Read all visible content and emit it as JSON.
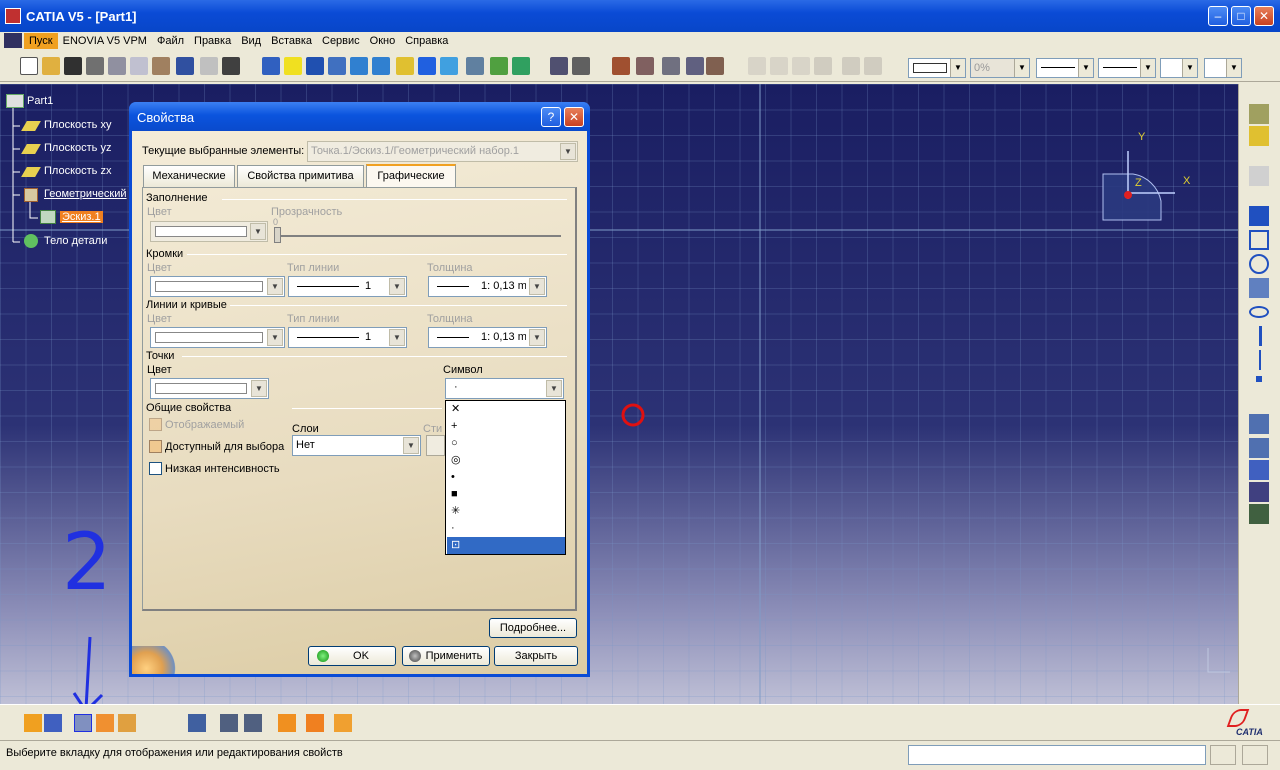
{
  "window": {
    "title": "CATIA V5 - [Part1]"
  },
  "menu": [
    "Пуск",
    "ENOVIA V5 VPM",
    "Файл",
    "Правка",
    "Вид",
    "Вставка",
    "Сервис",
    "Окно",
    "Справка"
  ],
  "toolbar": {
    "combo_percent": "0%"
  },
  "tree": {
    "root": "Part1",
    "items": [
      "Плоскость xy",
      "Плоскость yz",
      "Плоскость zx",
      "Геометрический",
      "Эскиз.1",
      "Тело детали"
    ]
  },
  "axes": {
    "y": "Y",
    "x": "X",
    "z": "Z"
  },
  "dialog": {
    "title": "Свойства",
    "help": "?",
    "selected_label": "Текущие выбранные элементы:",
    "selected_value": "Точка.1/Эскиз.1/Геометрический набор.1",
    "tabs": [
      "Механические",
      "Свойства примитива",
      "Графические"
    ],
    "fill": {
      "section": "Заполнение",
      "color": "Цвет",
      "transparency": "Прозрачность",
      "tick": "0"
    },
    "edges": {
      "section": "Кромки",
      "color": "Цвет",
      "line_type": "Тип линии",
      "line_value": "1",
      "thickness": "Толщина",
      "thickness_value": "1: 0,13 mr"
    },
    "lines": {
      "section": "Линии и кривые",
      "color": "Цвет",
      "line_type": "Тип линии",
      "line_value": "1",
      "thickness": "Толщина",
      "thickness_value": "1: 0,13 mr"
    },
    "points": {
      "section": "Точки",
      "color": "Цвет",
      "symbol": "Символ",
      "symbol_value": "·",
      "symbol_options": [
        "✕",
        "+",
        "○",
        "◎",
        "•",
        "■",
        "✳",
        "·",
        "⊡"
      ]
    },
    "general": {
      "section": "Общие свойства",
      "shown": "Отображаемый",
      "selectable": "Доступный для выбора",
      "low_intensity": "Низкая интенсивность",
      "layers": "Слои",
      "layer_value": "Нет",
      "style_trunc": "Сти"
    },
    "more_button": "Подробнее...",
    "ok_button": "OK",
    "apply_button": "Применить",
    "close_button": "Закрыть"
  },
  "annotations": {
    "one": "1",
    "two": "2"
  },
  "brand": "CATIA",
  "status": {
    "text": "Выберите вкладку для отображения или редактирования свойств"
  }
}
